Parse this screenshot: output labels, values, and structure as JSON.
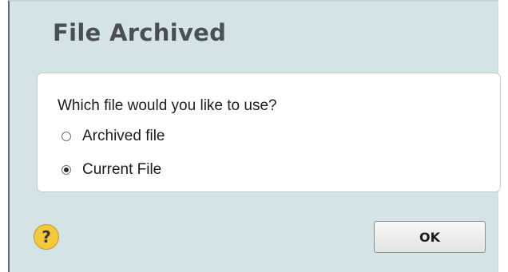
{
  "dialog": {
    "title": "File Archived",
    "question": "Which file would you like to use?",
    "options": [
      {
        "label": "Archived file",
        "checked": false
      },
      {
        "label": "Current File",
        "checked": true
      }
    ],
    "help_label": "?",
    "ok_label": "OK"
  },
  "colors": {
    "dialog_background": "#d4e3e5",
    "panel_background": "#ffffff",
    "title_text": "#4a4f55",
    "help_icon": "#f4c93a"
  },
  "icons": {
    "help": "help-icon"
  }
}
